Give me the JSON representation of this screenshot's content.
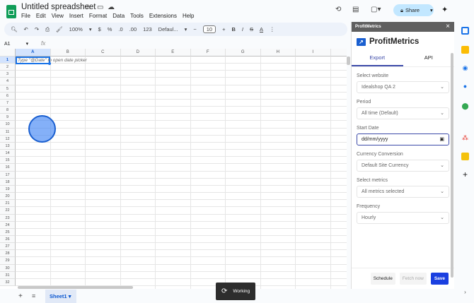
{
  "app": {
    "title": "Untitled spreadsheet",
    "menu": [
      "File",
      "Edit",
      "View",
      "Insert",
      "Format",
      "Data",
      "Tools",
      "Extensions",
      "Help"
    ],
    "share_label": "Share"
  },
  "toolbar": {
    "zoom": "100%",
    "currency": "$",
    "percent": "%",
    "dec_less": ".0",
    "dec_more": ".00",
    "format_123": "123",
    "font": "Defaul...",
    "font_size": "10",
    "bold": "B",
    "italic": "I",
    "strike": "S",
    "text_color": "A"
  },
  "formula_bar": {
    "cell_ref": "A1",
    "fx": "fx"
  },
  "grid": {
    "columns": [
      "A",
      "B",
      "C",
      "D",
      "E",
      "F",
      "G",
      "H",
      "I"
    ],
    "rows": [
      "1",
      "2",
      "3",
      "4",
      "5",
      "6",
      "7",
      "8",
      "9",
      "10",
      "11",
      "12",
      "13",
      "14",
      "15",
      "16",
      "17",
      "18",
      "19",
      "20",
      "21",
      "22",
      "23",
      "24",
      "25",
      "26",
      "27",
      "28",
      "29",
      "30",
      "31",
      "32"
    ],
    "a1_hint": "Type \"@Date\" to open date picker"
  },
  "sheets": {
    "active": "Sheet1"
  },
  "toast": {
    "label": "Working"
  },
  "panel": {
    "header": "ProfitMetrics",
    "brand": "ProfitMetrics",
    "tabs": [
      "Export",
      "API"
    ],
    "active_tab": "Export",
    "fields": [
      {
        "label": "Select website",
        "value": "Idealshop QA 2"
      },
      {
        "label": "Period",
        "value": "All time (Default)"
      },
      {
        "label": "Start Date",
        "value": "dd/mm/yyyy"
      },
      {
        "label": "Currency Conversion",
        "value": "Default Site Currency"
      },
      {
        "label": "Select metrics",
        "value": "All metrics selected"
      },
      {
        "label": "Frequency",
        "value": "Hourly"
      }
    ],
    "buttons": {
      "schedule": "Schedule",
      "fetch": "Fetch now",
      "save": "Save"
    }
  },
  "colors": {
    "accent": "#1a3fe0",
    "share_bg": "#c2e7ff",
    "sheets_green": "#0f9d58"
  }
}
